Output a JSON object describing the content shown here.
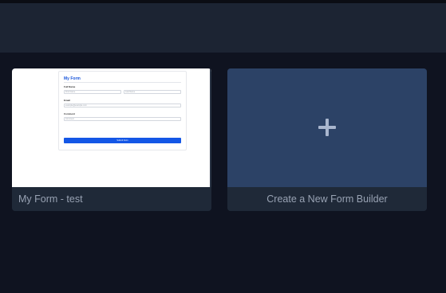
{
  "cards": {
    "form": {
      "title": "My Form - test",
      "preview": {
        "form_title": "My Form",
        "fields": [
          {
            "label": "Full Name",
            "inputs": [
              "First Name",
              "Last Name"
            ]
          },
          {
            "label": "Email",
            "inputs": [
              "example@example.com"
            ]
          },
          {
            "label": "Comment",
            "inputs": [
              "Comment"
            ]
          }
        ],
        "submit_label": "Submit Form"
      }
    },
    "new": {
      "title": "Create a New Form Builder",
      "icon": "plus-icon"
    }
  },
  "colors": {
    "background": "#0f1320",
    "header": "#1c2433",
    "card_caption": "#1f2938",
    "new_card": "#2c4266",
    "accent": "#1457e6"
  }
}
